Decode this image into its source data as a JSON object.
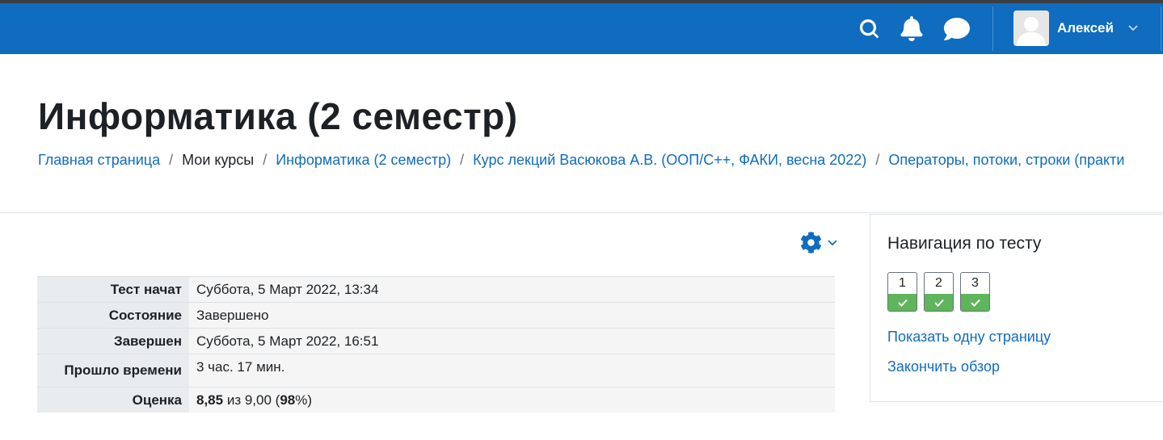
{
  "navbar": {
    "bg_color": "#0f6cbf",
    "icons": [
      "search-icon",
      "bell-icon",
      "chat-icon"
    ],
    "user": {
      "name": "Алексей",
      "avatar_icon": "user-avatar-icon"
    }
  },
  "page": {
    "title": "Информатика (2 семестр)"
  },
  "breadcrumb": [
    {
      "label": "Главная страница",
      "link": true
    },
    {
      "label": "Мои курсы",
      "link": false
    },
    {
      "label": "Информатика (2 семестр)",
      "link": true
    },
    {
      "label": "Курс лекций Васюкова А.В. (ООП/C++, ФАКИ, весна 2022)",
      "link": true
    },
    {
      "label": "Операторы, потоки, строки (практи",
      "link": true
    }
  ],
  "separator": "/",
  "summary": {
    "rows": [
      {
        "label": "Тест начат",
        "value": "Суббота, 5 Март 2022, 13:34"
      },
      {
        "label": "Состояние",
        "value": "Завершено"
      },
      {
        "label": "Завершен",
        "value": "Суббота, 5 Март 2022, 16:51"
      },
      {
        "label": "Прошло времени",
        "value": "3 час. 17 мин."
      }
    ],
    "grade": {
      "label": "Оценка",
      "score": "8,85",
      "of_text": " из 9,00 (",
      "percent": "98",
      "percent_suffix": "%)"
    }
  },
  "quiz_nav": {
    "title": "Навигация по тесту",
    "questions": [
      {
        "number": "1",
        "state": "correct"
      },
      {
        "number": "2",
        "state": "correct"
      },
      {
        "number": "3",
        "state": "correct"
      }
    ],
    "correct_color": "#5fb55b",
    "show_one_page": "Показать одну страницу",
    "finish_review": "Закончить обзор"
  }
}
